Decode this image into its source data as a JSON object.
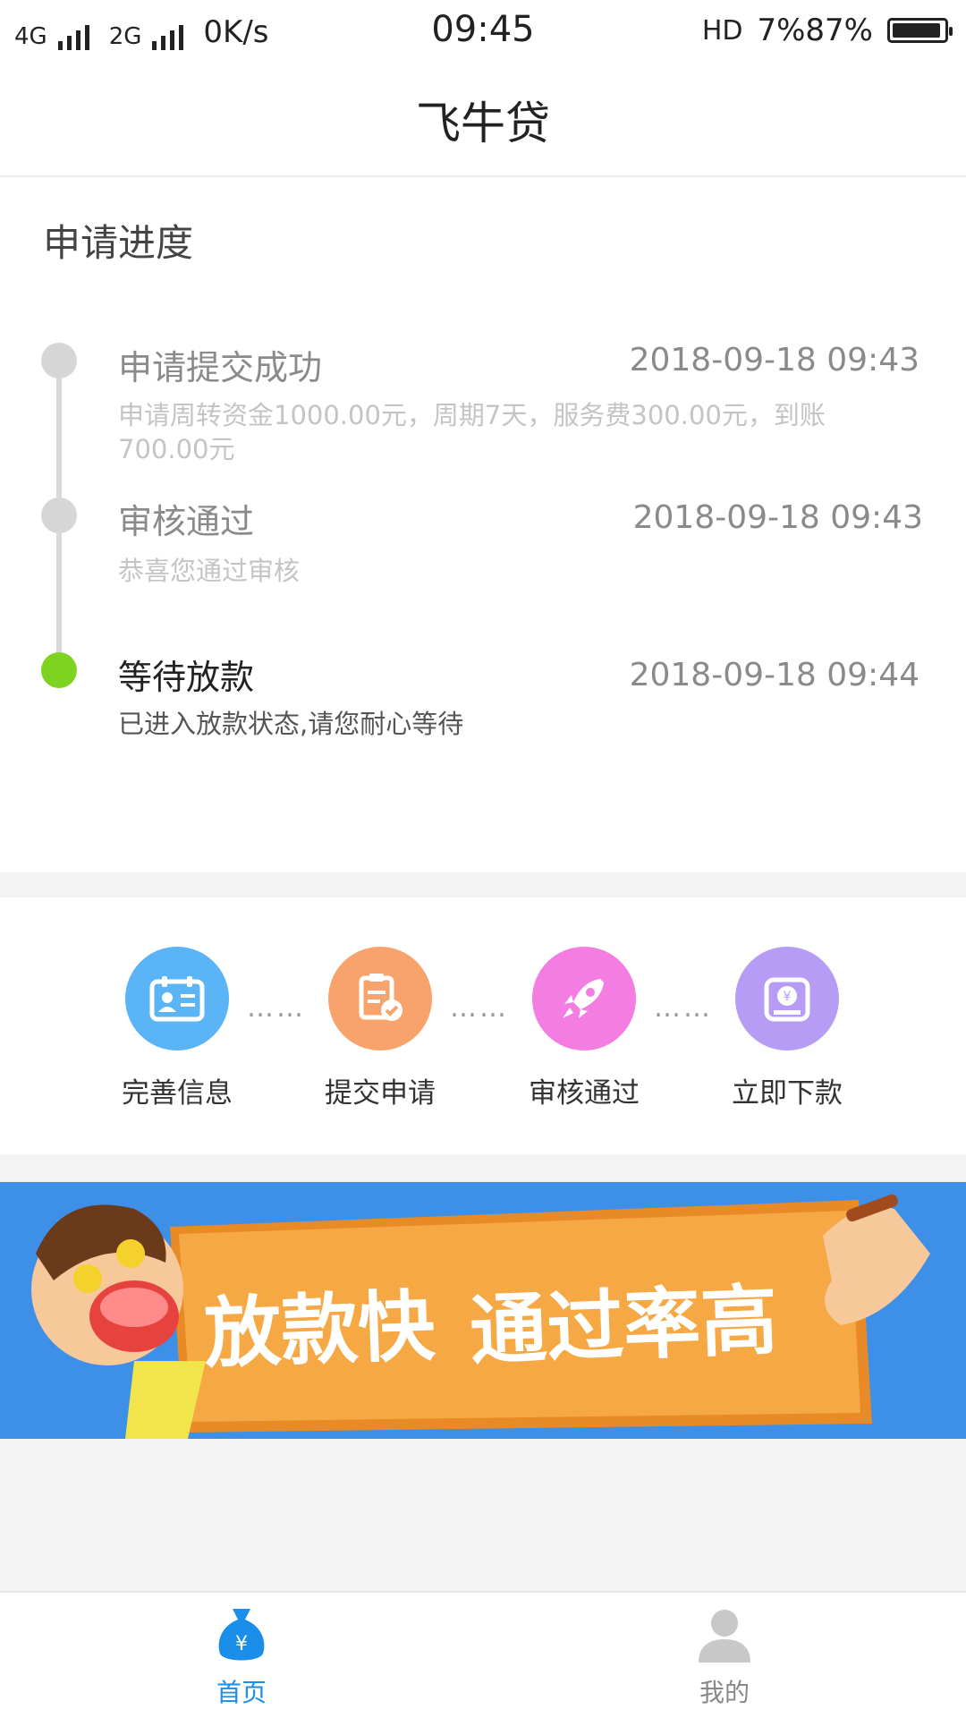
{
  "status_bar": {
    "net1": "4G",
    "net2": "2G",
    "speed": "0K/s",
    "time": "09:45",
    "hd": "HD",
    "battery_text": "7%87%"
  },
  "header": {
    "title": "飞牛贷"
  },
  "progress": {
    "section_title": "申请进度",
    "items": [
      {
        "title": "申请提交成功",
        "time": "2018-09-18  09:43",
        "desc": "申请周转资金1000.00元，周期7天，服务费300.00元，到账700.00元",
        "active": false
      },
      {
        "title": "审核通过",
        "time": "2018-09-18  09:43",
        "desc": "恭喜您通过审核",
        "active": false
      },
      {
        "title": "等待放款",
        "time": "2018-09-18  09:44",
        "desc": "已进入放款状态,请您耐心等待",
        "active": true
      }
    ],
    "active_color": "#7ed321"
  },
  "steps": {
    "connector": "……",
    "items": [
      {
        "label": "完善信息",
        "icon": "id-card-icon",
        "color": "#5ab4f5"
      },
      {
        "label": "提交申请",
        "icon": "clipboard-check-icon",
        "color": "#f7a36b"
      },
      {
        "label": "审核通过",
        "icon": "rocket-icon",
        "color": "#f37de0"
      },
      {
        "label": "立即下款",
        "icon": "yuan-bag-icon",
        "color": "#b69cf5"
      }
    ]
  },
  "banner": {
    "text1": "放款快",
    "text2": "通过率高",
    "bg_color": "#3d8fe8",
    "ribbon_color": "#f5a843"
  },
  "tabbar": {
    "tabs": [
      {
        "label": "首页",
        "icon": "money-bag-icon",
        "active": true
      },
      {
        "label": "我的",
        "icon": "user-icon",
        "active": false
      }
    ],
    "active_color": "#1a8ee8",
    "inactive_color": "#888888"
  }
}
